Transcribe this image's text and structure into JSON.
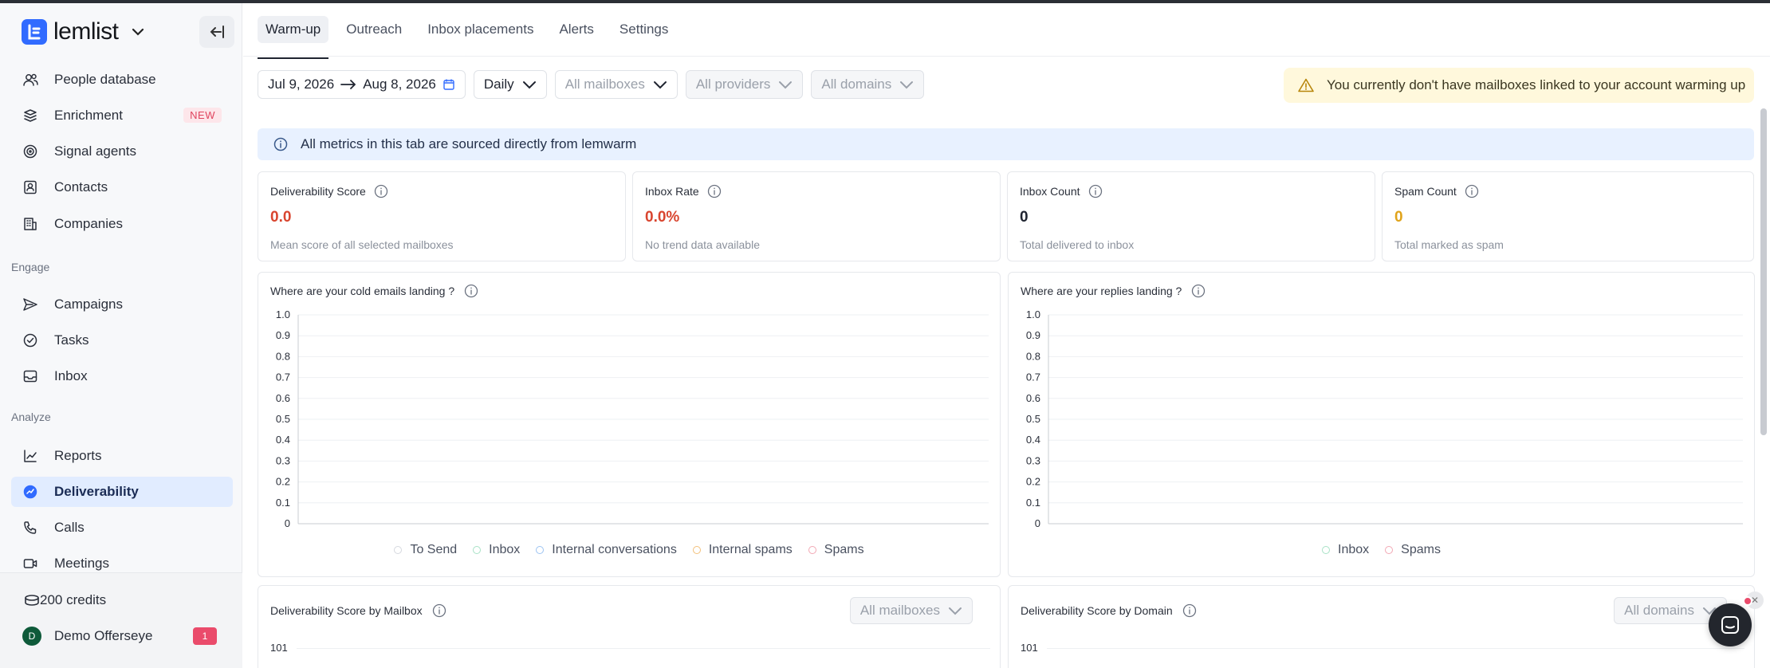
{
  "app": {
    "name": "lemlist"
  },
  "sidebar": {
    "items_top": [
      {
        "label": "People database",
        "icon": "people-icon"
      },
      {
        "label": "Enrichment",
        "icon": "enrichment-icon",
        "badge": "NEW"
      },
      {
        "label": "Signal agents",
        "icon": "signal-icon"
      },
      {
        "label": "Contacts",
        "icon": "contacts-icon"
      },
      {
        "label": "Companies",
        "icon": "companies-icon"
      }
    ],
    "engage_label": "Engage",
    "engage_items": [
      {
        "label": "Campaigns",
        "icon": "send-icon"
      },
      {
        "label": "Tasks",
        "icon": "check-circle-icon"
      },
      {
        "label": "Inbox",
        "icon": "inbox-icon"
      }
    ],
    "analyze_label": "Analyze",
    "analyze_items": [
      {
        "label": "Reports",
        "icon": "chart-line-icon"
      },
      {
        "label": "Deliverability",
        "icon": "deliverability-icon",
        "active": true
      },
      {
        "label": "Calls",
        "icon": "phone-icon"
      },
      {
        "label": "Meetings",
        "icon": "video-icon"
      }
    ],
    "credits": "200 credits",
    "user": {
      "initial": "D",
      "name": "Demo Offerseye",
      "notifications": "1"
    }
  },
  "tabs": [
    "Warm-up",
    "Outreach",
    "Inbox placements",
    "Alerts",
    "Settings"
  ],
  "filters": {
    "date_start": "Jul 9, 2026",
    "date_end": "Aug 8, 2026",
    "granularity": "Daily",
    "mailboxes": "All mailboxes",
    "providers": "All providers",
    "domains": "All domains"
  },
  "warning": "You currently don't have mailboxes linked to your account warming up",
  "info_banner": "All metrics in this tab are sourced directly from lemwarm",
  "metrics": [
    {
      "title": "Deliverability Score",
      "value": "0.0",
      "sub": "Mean score of all selected mailboxes",
      "color": "#d9452f"
    },
    {
      "title": "Inbox Rate",
      "value": "0.0%",
      "sub": "No trend data available",
      "color": "#d9452f"
    },
    {
      "title": "Inbox Count",
      "value": "0",
      "sub": "Total delivered to inbox",
      "color": "#1f2430"
    },
    {
      "title": "Spam Count",
      "value": "0",
      "sub": "Total marked as spam",
      "color": "#e0a31a"
    }
  ],
  "chart_data": [
    {
      "type": "line",
      "title": "Where are your cold emails landing ?",
      "y_ticks": [
        "0",
        "0.1",
        "0.2",
        "0.3",
        "0.4",
        "0.5",
        "0.6",
        "0.7",
        "0.8",
        "0.9",
        "1.0"
      ],
      "ylim": [
        0,
        1
      ],
      "grid": true,
      "series": [
        {
          "name": "To Send",
          "color": "#d5d8de",
          "values": []
        },
        {
          "name": "Inbox",
          "color": "#a8e2c6",
          "values": []
        },
        {
          "name": "Internal conversations",
          "color": "#9cc3f2",
          "values": []
        },
        {
          "name": "Internal spams",
          "color": "#f3c07a",
          "values": []
        },
        {
          "name": "Spams",
          "color": "#f2a8b4",
          "values": []
        }
      ],
      "legend": "bottom"
    },
    {
      "type": "line",
      "title": "Where are your replies landing ?",
      "y_ticks": [
        "0",
        "0.1",
        "0.2",
        "0.3",
        "0.4",
        "0.5",
        "0.6",
        "0.7",
        "0.8",
        "0.9",
        "1.0"
      ],
      "ylim": [
        0,
        1
      ],
      "grid": true,
      "series": [
        {
          "name": "Inbox",
          "color": "#a8e2c6",
          "values": []
        },
        {
          "name": "Spams",
          "color": "#f2a8b4",
          "values": []
        }
      ],
      "legend": "bottom"
    }
  ],
  "lower_cards": [
    {
      "title": "Deliverability Score by Mailbox",
      "select": "All mailboxes",
      "y_top": "101"
    },
    {
      "title": "Deliverability Score by Domain",
      "select": "All domains",
      "y_top": "101"
    }
  ]
}
